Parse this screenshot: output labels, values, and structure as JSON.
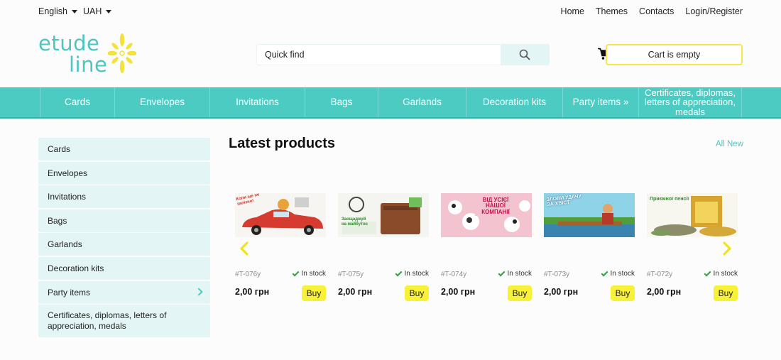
{
  "topbar": {
    "language": "English",
    "currency": "UAH",
    "links": [
      "Home",
      "Themes",
      "Contacts",
      "Login/Register"
    ]
  },
  "logo": {
    "line1": "etude",
    "line2": "line"
  },
  "search": {
    "placeholder": "Quick find"
  },
  "cart": {
    "label": "Cart is empty"
  },
  "nav": [
    "Cards",
    "Envelopes",
    "Invitations",
    "Bags",
    "Garlands",
    "Decoration kits",
    "Party items »",
    "Certificates, diplomas, letters of appreciation, medals"
  ],
  "sidebar": [
    "Cards",
    "Envelopes",
    "Invitations",
    "Bags",
    "Garlands",
    "Decoration kits",
    "Party items",
    "Certificates, diplomas, letters of appreciation, medals"
  ],
  "main": {
    "title": "Latest products",
    "all_new": "All New"
  },
  "products": [
    {
      "sku": "#T-076y",
      "stock": "In stock",
      "price": "2,00 грн",
      "buy": "Buy",
      "img_text": "Коли ще не запізно!"
    },
    {
      "sku": "#T-075y",
      "stock": "In stock",
      "price": "2,00 грн",
      "buy": "Buy",
      "img_text": "Заощаджуй на майбутнє"
    },
    {
      "sku": "#T-074y",
      "stock": "In stock",
      "price": "2,00 грн",
      "buy": "Buy",
      "img_text": "ВІД УСІЄЇ НАШОЇ КОМПАНІЇ"
    },
    {
      "sku": "#T-073y",
      "stock": "In stock",
      "price": "2,00 грн",
      "buy": "Buy",
      "img_text": "ЗЛОВИ УДАЧУ ЗА ХВІСТ"
    },
    {
      "sku": "#T-072y",
      "stock": "In stock",
      "price": "2,00 грн",
      "buy": "Buy",
      "img_text": "Приємної пенсії"
    }
  ],
  "colors": {
    "accent": "#4ccbc3",
    "button": "#f8f13a",
    "cart_border": "#f5e64a",
    "panel": "#e3f6f5"
  }
}
